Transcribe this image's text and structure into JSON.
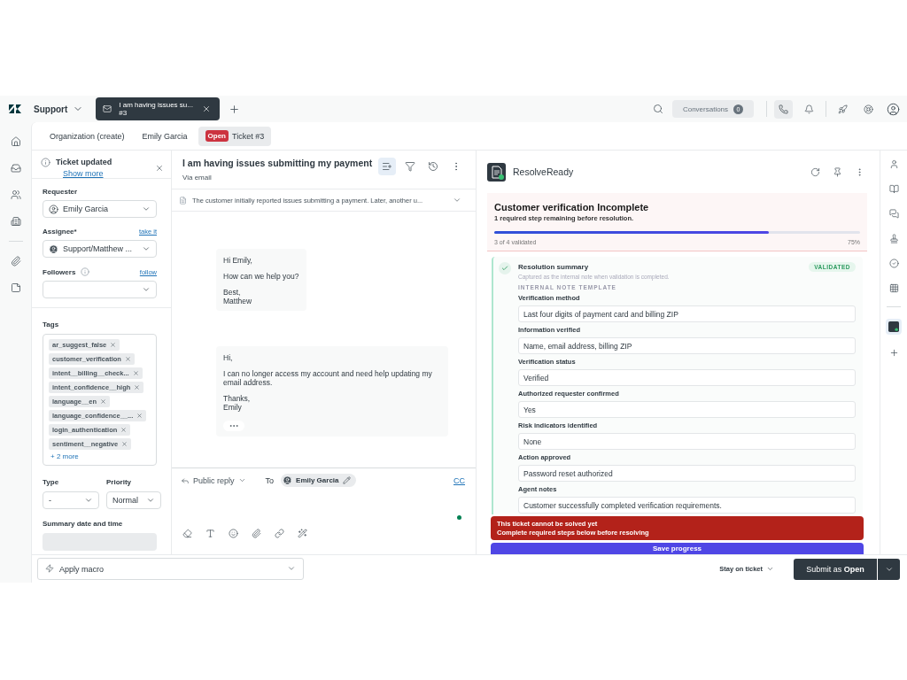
{
  "top_bar": {
    "product": "Support",
    "tabs": [
      {
        "title": "I am having issues su...",
        "subtitle": "#3",
        "selected": true
      }
    ],
    "conversations": {
      "label": "Conversations",
      "count": "0"
    }
  },
  "sub_tabs": [
    {
      "label": "Organization (create)",
      "selected": false
    },
    {
      "label": "Emily Garcia",
      "selected": false
    },
    {
      "badge": "Open",
      "label": "Ticket #3",
      "selected": true
    }
  ],
  "notice": {
    "title": "Ticket updated",
    "link": "Show more"
  },
  "requester": {
    "label": "Requester",
    "value": "Emily Garcia"
  },
  "assignee": {
    "label": "Assignee*",
    "action": "take it",
    "value": "Support/Matthew ..."
  },
  "followers": {
    "label": "Followers",
    "action": "follow"
  },
  "tags": {
    "label": "Tags",
    "items": [
      "ar_suggest_false",
      "customer_verification",
      "intent__billing__check...",
      "intent_confidence__high",
      "language__en",
      "language_confidence__...",
      "login_authentication",
      "sentiment__negative"
    ],
    "more": "+ 2 more"
  },
  "type": {
    "label": "Type",
    "value": "-"
  },
  "priority": {
    "label": "Priority",
    "value": "Normal"
  },
  "summary_date": {
    "label": "Summary date and time"
  },
  "ticket": {
    "title": "I am having issues submitting my payment",
    "channel": "Via email",
    "summary": "The customer initially reported issues submitting a payment. Later, another u..."
  },
  "messages": [
    {
      "paragraphs": [
        "Hi Emily,",
        "How can we help you?",
        "Best,\nMatthew"
      ],
      "collapsed": false
    },
    {
      "paragraphs": [
        "Hi,",
        "I can no longer access my account and need help updating my email address.",
        "Thanks,\nEmily"
      ],
      "collapsed": true
    }
  ],
  "composer": {
    "mode": "Public reply",
    "to_label": "To",
    "recipient": "Emily Garcia",
    "cc": "CC"
  },
  "macro": {
    "placeholder": "Apply macro"
  },
  "footer": {
    "stay": "Stay on ticket",
    "submit": "Submit as **Open**"
  },
  "app": {
    "name": "ResolveReady",
    "status": {
      "title": "Customer verification Incomplete",
      "subtitle": "1 required step remaining before resolution.",
      "level": 0.75,
      "progress_label": "3 of 4 validated",
      "percent": "75%"
    },
    "step": {
      "title": "Resolution summary",
      "checked": true,
      "badge": "VALIDATED",
      "description": "Captured as the internal note when validation is completed.",
      "section": "INTERNAL NOTE TEMPLATE",
      "fields": [
        {
          "label": "Verification method",
          "value": "Last four digits of payment card and billing ZIP"
        },
        {
          "label": "Information verified",
          "value": "Name, email address, billing ZIP"
        },
        {
          "label": "Verification status",
          "value": "Verified"
        },
        {
          "label": "Authorized requester confirmed",
          "value": "Yes"
        },
        {
          "label": "Risk indicators identified",
          "value": "None"
        },
        {
          "label": "Action approved",
          "value": "Password reset authorized"
        },
        {
          "label": "Agent notes",
          "value": "Customer successfully completed verification requirements."
        }
      ]
    },
    "alert": {
      "lines": [
        "This ticket cannot be solved yet",
        "Complete required steps below before resolving"
      ]
    },
    "save": "Save progress"
  }
}
